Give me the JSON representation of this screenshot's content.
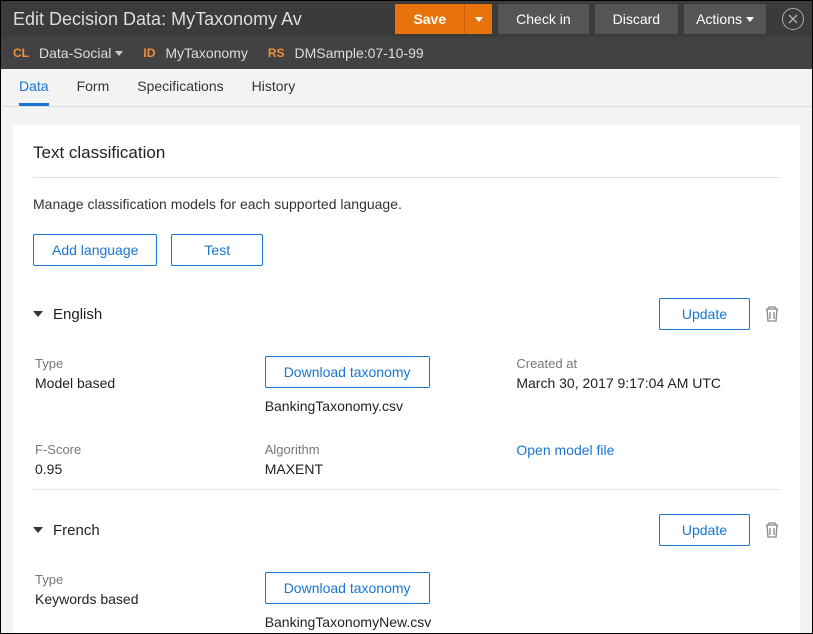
{
  "header": {
    "title": "Edit Decision Data: MyTaxonomy  Av",
    "save": "Save",
    "check_in": "Check in",
    "discard": "Discard",
    "actions": "Actions"
  },
  "subheader": {
    "cl_tag": "CL",
    "cl_value": "Data-Social",
    "id_tag": "ID",
    "id_value": "MyTaxonomy",
    "rs_tag": "RS",
    "rs_value": "DMSample:07-10-99"
  },
  "tabs": {
    "data": "Data",
    "form": "Form",
    "specifications": "Specifications",
    "history": "History"
  },
  "panel": {
    "title": "Text classification",
    "desc": "Manage classification models for each supported language.",
    "add_language": "Add language",
    "test": "Test"
  },
  "languages": [
    {
      "name": "English",
      "update": "Update",
      "type_label": "Type",
      "type_value": "Model based",
      "download_label": "Download taxonomy",
      "file": "BankingTaxonomy.csv",
      "created_label": "Created at",
      "created_value": "March 30, 2017 9:17:04 AM UTC",
      "fscore_label": "F-Score",
      "fscore_value": "0.95",
      "algorithm_label": "Algorithm",
      "algorithm_value": "MAXENT",
      "open_model": "Open model file"
    },
    {
      "name": "French",
      "update": "Update",
      "type_label": "Type",
      "type_value": "Keywords based",
      "download_label": "Download taxonomy",
      "file": "BankingTaxonomyNew.csv"
    }
  ]
}
